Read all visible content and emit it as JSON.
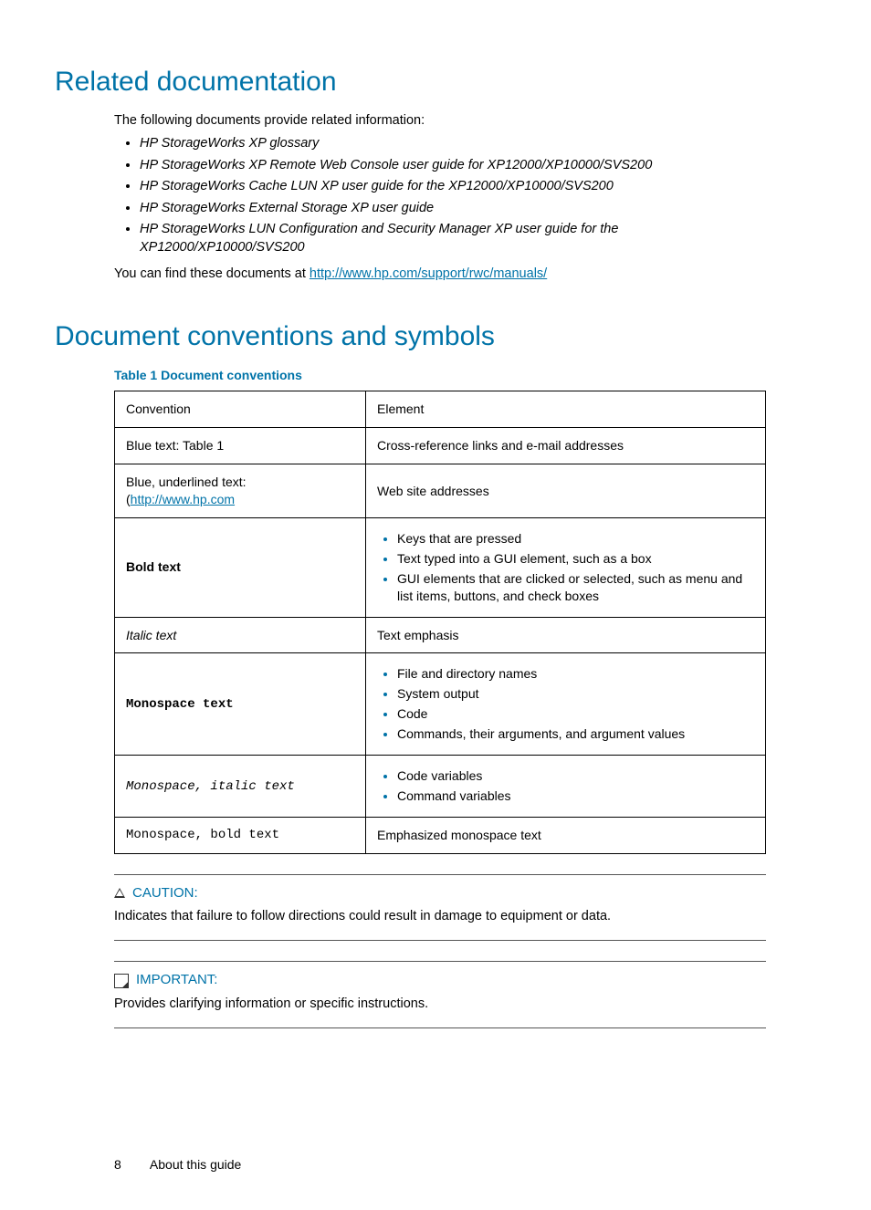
{
  "section1": {
    "heading": "Related documentation",
    "intro": "The following documents provide related information:",
    "docs": [
      "HP StorageWorks XP glossary",
      "HP StorageWorks XP Remote Web Console user guide for XP12000/XP10000/SVS200",
      "HP StorageWorks Cache LUN XP user guide for the XP12000/XP10000/SVS200",
      "HP StorageWorks External Storage XP user guide",
      "HP StorageWorks LUN Configuration and Security Manager XP user guide for the XP12000/XP10000/SVS200"
    ],
    "outro_pre": "You can find these documents at ",
    "outro_link": "http://www.hp.com/support/rwc/manuals/"
  },
  "section2": {
    "heading": "Document conventions and symbols",
    "table_caption": "Table 1 Document conventions",
    "header": {
      "c1": "Convention",
      "c2": "Element"
    },
    "rows": {
      "r1": {
        "c1a": "Blue text: ",
        "c1b": "Table 1",
        "c2": "Cross-reference links and e-mail addresses"
      },
      "r2": {
        "c1a": "Blue, underlined text: (",
        "c1b": "http://www.hp.com",
        "c1c": "",
        "c2": "Web site addresses"
      },
      "r3": {
        "c1": "Bold text",
        "items": [
          "Keys that are pressed",
          "Text typed into a GUI element, such as a box",
          "GUI elements that are clicked or selected, such as menu and list items, buttons, and check boxes"
        ]
      },
      "r4": {
        "c1": "Italic text",
        "c2": "Text emphasis"
      },
      "r5": {
        "c1": "Monospace text",
        "items": [
          "File and directory names",
          "System output",
          "Code",
          "Commands, their arguments, and argument values"
        ]
      },
      "r6": {
        "c1": "Monospace, italic text",
        "items": [
          "Code variables",
          "Command variables"
        ]
      },
      "r7": {
        "c1": "Monospace, bold text",
        "c2": "Emphasized monospace text"
      }
    }
  },
  "caution": {
    "label": "CAUTION:",
    "text": "Indicates that failure to follow directions could result in damage to equipment or data."
  },
  "important": {
    "label": "IMPORTANT:",
    "text": "Provides clarifying information or specific instructions."
  },
  "footer": {
    "page": "8",
    "title": "About this guide"
  }
}
